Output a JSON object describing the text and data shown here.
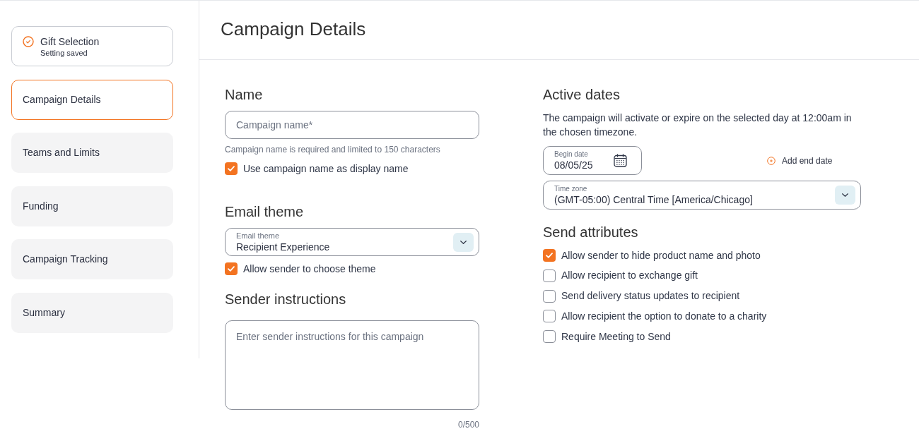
{
  "sidebar": {
    "items": [
      {
        "title": "Gift Selection",
        "subtitle": "Setting saved",
        "saved": true,
        "selected": false
      },
      {
        "title": "Campaign Details",
        "saved": false,
        "selected": true
      },
      {
        "title": "Teams and Limits",
        "saved": false,
        "selected": false
      },
      {
        "title": "Funding",
        "saved": false,
        "selected": false
      },
      {
        "title": "Campaign Tracking",
        "saved": false,
        "selected": false
      },
      {
        "title": "Summary",
        "saved": false,
        "selected": false
      }
    ]
  },
  "header": {
    "title": "Campaign Details"
  },
  "name_section": {
    "heading": "Name",
    "field": {
      "placeholder": "Campaign name*"
    },
    "helper": "Campaign name is required and limited to 150 characters",
    "checkbox": {
      "label": "Use campaign name as display name",
      "checked": true
    }
  },
  "email_theme": {
    "heading": "Email theme",
    "select": {
      "label": "Email theme",
      "value": "Recipient Experience"
    },
    "checkbox": {
      "label": "Allow sender to choose theme",
      "checked": true
    }
  },
  "sender_instructions": {
    "heading": "Sender instructions",
    "field": {
      "placeholder": "Enter sender instructions for this campaign"
    },
    "counter": "0/500"
  },
  "active_dates": {
    "heading": "Active dates",
    "description": "The campaign will activate or expire on the selected day at 12:00am in the chosen timezone.",
    "begin_date": {
      "label": "Begin date",
      "value": "08/05/25"
    },
    "add_end_date": "Add end date",
    "time_zone": {
      "label": "Time zone",
      "value": "(GMT-05:00) Central Time [America/Chicago]"
    }
  },
  "send_attributes": {
    "heading": "Send attributes",
    "options": [
      {
        "label": "Allow sender to hide product name and photo",
        "checked": true
      },
      {
        "label": "Allow recipient to exchange gift",
        "checked": false
      },
      {
        "label": "Send delivery status updates to recipient",
        "checked": false
      },
      {
        "label": "Allow recipient the option to donate to a charity",
        "checked": false
      },
      {
        "label": "Require Meeting to Send",
        "checked": false
      }
    ]
  }
}
